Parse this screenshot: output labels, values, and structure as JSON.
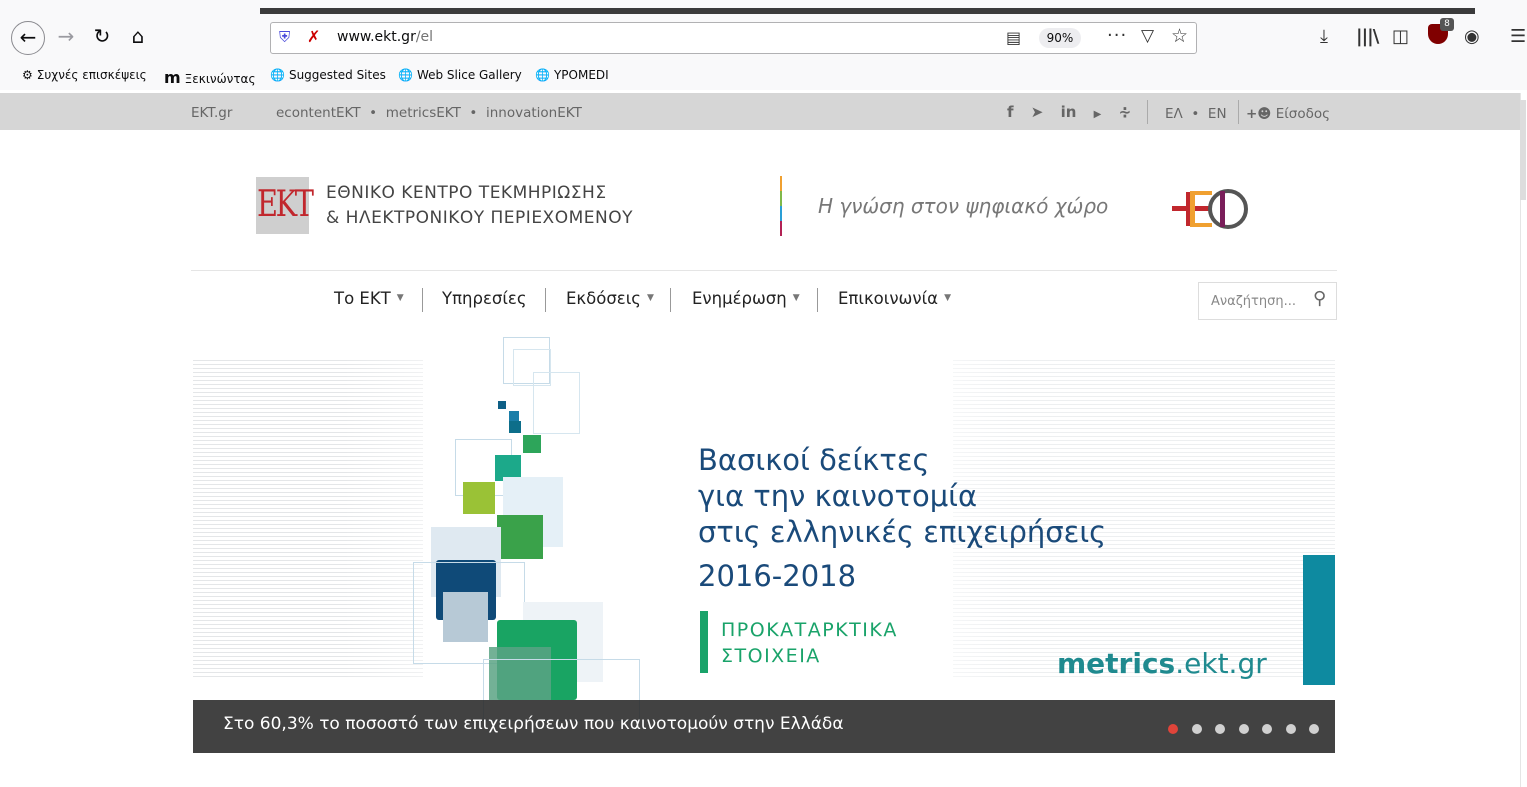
{
  "browser": {
    "url_host": "www.ekt.gr",
    "url_path": "/el",
    "zoom": "90%",
    "ublock_badge": "8",
    "icons": {
      "back": "back-arrow-icon",
      "forward": "forward-arrow-icon",
      "reload": "reload-icon",
      "home": "home-icon",
      "shield": "tracking-shield-icon",
      "insecure": "insecure-connection-icon",
      "reader": "reader-view-icon",
      "more": "page-actions-icon",
      "pocket": "pocket-icon",
      "star": "bookmark-star-icon",
      "download": "download-icon",
      "library": "library-icon",
      "sidebar": "sidebar-icon",
      "ublock": "ublock-icon",
      "account": "account-icon",
      "menu": "hamburger-menu-icon"
    }
  },
  "bookmarks": [
    {
      "label": "Συχνές επισκέψεις",
      "icon": "gear-icon"
    },
    {
      "label": "Ξεκινώντας",
      "icon": "m-logo-icon"
    },
    {
      "label": "Suggested Sites",
      "icon": "globe-icon"
    },
    {
      "label": "Web Slice Gallery",
      "icon": "globe-icon"
    },
    {
      "label": "YPOMEDI",
      "icon": "globe-icon"
    }
  ],
  "sitebar": {
    "home": "EKT.gr",
    "links": [
      "econtentEKT",
      "metricsEKT",
      "innovationEKT"
    ],
    "link_sep": "•",
    "social": [
      "facebook-icon",
      "twitter-icon",
      "linkedin-icon",
      "youtube-icon",
      "rss-icon"
    ],
    "lang_el": "ΕΛ",
    "lang_en": "EN",
    "login": "Είσοδος"
  },
  "header": {
    "logo": "EKT",
    "org_line1": "ΕΘΝΙΚΟ ΚΕΝΤΡΟ ΤΕΚΜΗΡΙΩΣΗΣ",
    "org_line2": "& ΗΛΕΚΤΡΟΝΙΚΟΥ ΠΕΡΙΕΧΟΜΕΝΟΥ",
    "tagline": "Η γνώση στον ψηφιακό χώρο"
  },
  "nav": {
    "items": [
      {
        "label": "Το ΕΚΤ",
        "dropdown": true
      },
      {
        "label": "Υπηρεσίες",
        "dropdown": false
      },
      {
        "label": "Εκδόσεις",
        "dropdown": true
      },
      {
        "label": "Ενημέρωση",
        "dropdown": true
      },
      {
        "label": "Επικοινωνία",
        "dropdown": true
      }
    ],
    "caret": "▼",
    "search_placeholder": "Αναζήτηση..."
  },
  "hero": {
    "title_line1": "Βασικοί δείκτες",
    "title_line2": "για την καινοτομία",
    "title_line3": "στις ελληνικές επιχειρήσεις",
    "years": "2016-2018",
    "prelim_line1": "ΠΡΟΚΑΤΑΡΚΤΙΚΑ",
    "prelim_line2": "ΣΤΟΙΧΕΙΑ",
    "metrics_bold": "metrics",
    "metrics_rest": ".ekt.gr",
    "caption": "Στο 60,3% το ποσοστό των επιχειρήσεων που καινοτομούν στην Ελλάδα",
    "slide_count": 7,
    "active_slide": 1,
    "colors": {
      "title": "#1a4a7a",
      "green": "#1aa36a",
      "teal": "#0e8aa0",
      "dot_active": "#e0443a"
    }
  }
}
